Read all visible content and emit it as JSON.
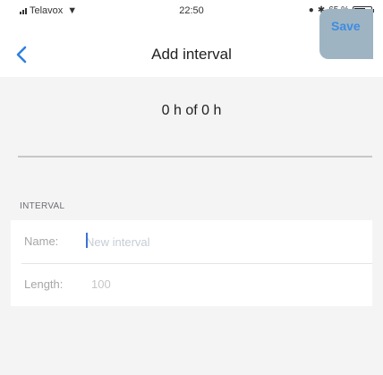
{
  "status_bar": {
    "carrier": "Telavox",
    "time": "22:50",
    "battery": "65 %",
    "battery_level": 0.65
  },
  "nav": {
    "title": "Add interval",
    "save_label": "Save"
  },
  "summary": {
    "text": "0 h of 0 h"
  },
  "form": {
    "section_header": "INTERVAL",
    "name_label": "Name:",
    "name_placeholder": "New interval",
    "name_value": "",
    "length_label": "Length:",
    "length_value": "100"
  }
}
